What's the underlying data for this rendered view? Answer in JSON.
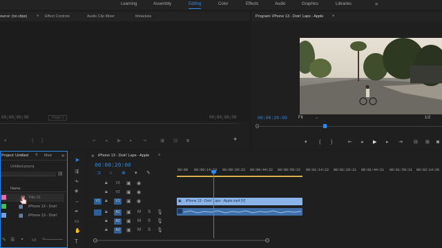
{
  "workspaces": [
    "Learning",
    "Assembly",
    "Editing",
    "Color",
    "Effects",
    "Audio",
    "Graphics",
    "Libraries"
  ],
  "active_workspace": "Editing",
  "more_glyph": "»",
  "source": {
    "tabs": [
      "ource: (no clips)",
      "Effect Controls",
      "Audio Clip Mixer",
      "Metadata"
    ],
    "menu_glyph": "≡",
    "tc_in": "00;00;00;00",
    "tc_out": "00;00;00;00",
    "page": "Page 1"
  },
  "program": {
    "title": "Program: iPhone 13 - Doin' Laps - Apple",
    "menu_glyph": "≡",
    "tc_in": "00:00:20:00",
    "fit": "Fit",
    "page": "1/2"
  },
  "project": {
    "tab": "Project: Untitled",
    "tab2": "Med",
    "more": "»",
    "filename": "Untitled.prproj",
    "name_header": "Name",
    "items": [
      {
        "label": "Title 01",
        "color": "#e06fb5"
      },
      {
        "label": "iPhone 13 - Doin'",
        "color": "#4fb55c"
      },
      {
        "label": "iPhone 13 - Doin'",
        "color": "#7a9fd6"
      }
    ]
  },
  "timeline": {
    "tab": "iPhone 13 - Doin' Laps - Apple",
    "menu_glyph": "≡",
    "timecode": "00:00:20:00",
    "ruler": [
      "00:00",
      "00:00:14:23",
      "00:00:29:23",
      "00:00:44:22",
      "00:00:59:22",
      "00:01:14:22",
      "00:01:29:21",
      "00:01:44:21",
      "00:01:59:21",
      "00:02:14:20"
    ],
    "video_tracks": [
      "V3",
      "V2",
      "V1"
    ],
    "audio_tracks": [
      "A1",
      "A2",
      "A3"
    ],
    "src_v": "V1",
    "video_clip_label": "iPhone 13 - Doin' Laps - Apple.mp4 [V]",
    "audio_track_buttons": [
      "M",
      "S"
    ],
    "accent": "#2d8ceb"
  },
  "icons": {
    "eye": "👁",
    "lock": "🔒",
    "play": "▶",
    "add": "+"
  }
}
